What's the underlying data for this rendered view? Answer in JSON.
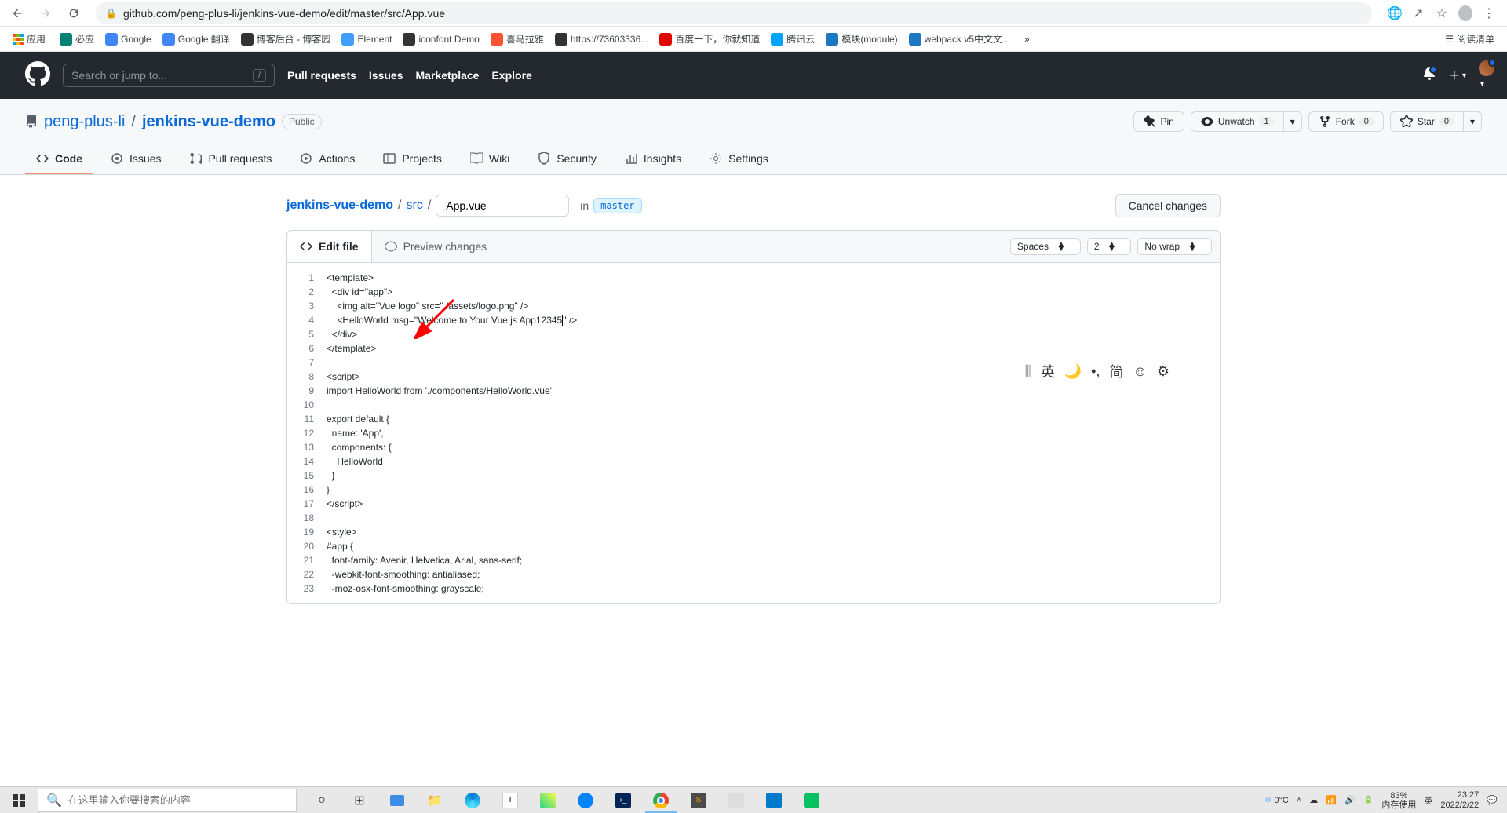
{
  "browser": {
    "url": "github.com/peng-plus-li/jenkins-vue-demo/edit/master/src/App.vue",
    "bookmarks_label": "应用",
    "bookmarks": [
      {
        "label": "必应",
        "color": "#008373"
      },
      {
        "label": "Google",
        "color": "#4285f4"
      },
      {
        "label": "Google 翻译",
        "color": "#4285f4"
      },
      {
        "label": "博客后台 - 博客园",
        "color": "#333"
      },
      {
        "label": "Element",
        "color": "#409eff"
      },
      {
        "label": "iconfont Demo",
        "color": "#333"
      },
      {
        "label": "喜马拉雅",
        "color": "#ff5232"
      },
      {
        "label": "https://73603336...",
        "color": "#333"
      },
      {
        "label": "百度一下，你就知道",
        "color": "#e10602"
      },
      {
        "label": "腾讯云",
        "color": "#00a4ff"
      },
      {
        "label": "模块(module)",
        "color": "#1c78c0"
      },
      {
        "label": "webpack v5中文文...",
        "color": "#1c78c0"
      }
    ],
    "reading_list": "阅读清单"
  },
  "github": {
    "search_placeholder": "Search or jump to...",
    "nav": [
      "Pull requests",
      "Issues",
      "Marketplace",
      "Explore"
    ]
  },
  "repo": {
    "owner": "peng-plus-li",
    "name": "jenkins-vue-demo",
    "visibility": "Public",
    "actions": {
      "pin": "Pin",
      "watch": "Unwatch",
      "watch_count": "1",
      "fork": "Fork",
      "fork_count": "0",
      "star": "Star",
      "star_count": "0"
    },
    "tabs": [
      {
        "label": "Code",
        "icon": "code"
      },
      {
        "label": "Issues",
        "icon": "issue"
      },
      {
        "label": "Pull requests",
        "icon": "pr"
      },
      {
        "label": "Actions",
        "icon": "play"
      },
      {
        "label": "Projects",
        "icon": "project"
      },
      {
        "label": "Wiki",
        "icon": "wiki"
      },
      {
        "label": "Security",
        "icon": "shield"
      },
      {
        "label": "Insights",
        "icon": "graph"
      },
      {
        "label": "Settings",
        "icon": "gear"
      }
    ]
  },
  "file": {
    "repo_link": "jenkins-vue-demo",
    "path_src": "src",
    "filename": "App.vue",
    "in_label": "in",
    "branch": "master",
    "cancel": "Cancel changes",
    "edit_tab": "Edit file",
    "preview_tab": "Preview changes",
    "options": {
      "indent": "Spaces",
      "size": "2",
      "wrap": "No wrap"
    },
    "code_lines": [
      "<template>",
      "  <div id=\"app\">",
      "    <img alt=\"Vue logo\" src=\"./assets/logo.png\" />",
      "    <HelloWorld msg=\"Welcome to Your Vue.js App12345\" />",
      "  </div>",
      "</template>",
      "",
      "<script>",
      "import HelloWorld from './components/HelloWorld.vue'",
      "",
      "export default {",
      "  name: 'App',",
      "  components: {",
      "    HelloWorld",
      "  }",
      "}",
      "</script>",
      "",
      "<style>",
      "#app {",
      "  font-family: Avenir, Helvetica, Arial, sans-serif;",
      "  -webkit-font-smoothing: antialiased;",
      "  -moz-osx-font-smoothing: grayscale;"
    ]
  },
  "ime": {
    "items": [
      "英",
      "🌙",
      "•,",
      "简",
      "☺",
      "⚙"
    ]
  },
  "taskbar": {
    "search_placeholder": "在这里输入你要搜索的内容",
    "weather": "0°C",
    "mem_pct": "83%",
    "mem_label": "内存使用",
    "lang": "英",
    "time": "23:27",
    "date": "2022/2/22"
  }
}
